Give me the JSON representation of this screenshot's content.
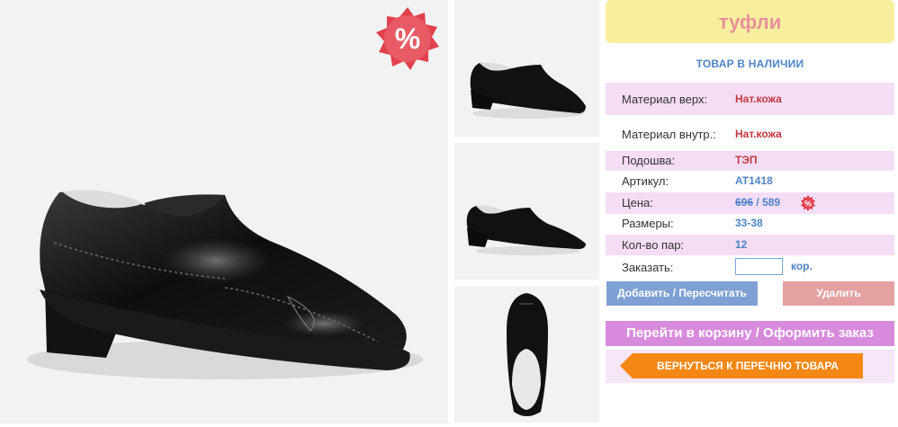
{
  "product": {
    "title": "туфли",
    "stock_status": "ТОВАР В НАЛИЧИИ",
    "discount_badge": "%"
  },
  "specs": {
    "material_top": {
      "label": "Материал верх:",
      "value": "Нат.кожа"
    },
    "material_inner": {
      "label": "Материал внутр.:",
      "value": "Нат.кожа"
    },
    "sole": {
      "label": "Подошва:",
      "value": "ТЭП"
    },
    "article": {
      "label": "Артикул:",
      "value": "AT1418"
    },
    "price": {
      "label": "Цена:",
      "old": "696",
      "separator": "/",
      "new": "589",
      "badge": "%"
    },
    "sizes": {
      "label": "Размеры:",
      "value": "33-38"
    },
    "pairs": {
      "label": "Кол-во пар:",
      "value": "12"
    },
    "order": {
      "label": "Заказать:",
      "value": "",
      "unit": "кор."
    }
  },
  "buttons": {
    "add": "Добавить / Пересчитать",
    "delete": "Удалить",
    "cart": "Перейти в корзину / Оформить заказ",
    "back": "ВЕРНУТЬСЯ К ПЕРЕЧНЮ ТОВАРА"
  },
  "colors": {
    "title_bg": "#f8ef9e",
    "title_text": "#e7919b",
    "accent_blue": "#4f84c7",
    "accent_red": "#c0393f",
    "highlight_row": "#f5ddf6",
    "cart_button": "#d88bdd",
    "back_button": "#f58714"
  },
  "images": {
    "main": "black-leather-shoe-side",
    "thumbs": [
      "shoe-side-view",
      "shoe-side-view-small",
      "shoe-top-view"
    ]
  }
}
